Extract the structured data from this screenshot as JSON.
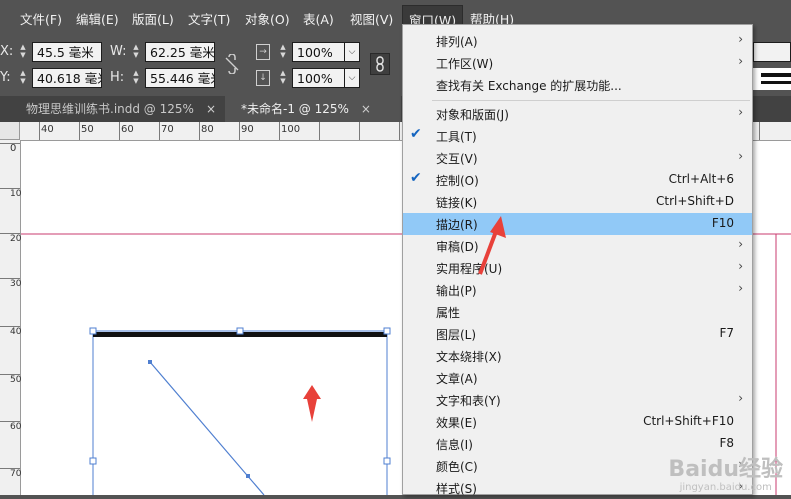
{
  "menubar": {
    "items": [
      "文件(F)",
      "编辑(E)",
      "版面(L)",
      "文字(T)",
      "对象(O)",
      "表(A)",
      "视图(V)",
      "窗口(W)",
      "帮助(H)"
    ],
    "active_index": 7
  },
  "control_panel": {
    "x_label": "X:",
    "x_value": "45.5 毫米",
    "y_label": "Y:",
    "y_value": "40.618 毫米",
    "w_label": "W:",
    "w_value": "62.25 毫米",
    "h_label": "H:",
    "h_value": "55.446 毫米",
    "scale_x": "100%",
    "scale_y": "100%"
  },
  "tabs": [
    {
      "label": "物理思维训练书.indd @ 125%",
      "close": "×",
      "active": false
    },
    {
      "label": "*未命名-1 @ 125%",
      "close": "×",
      "active": true
    }
  ],
  "ruler": {
    "h_labels": [
      "40",
      "50",
      "60",
      "70",
      "80",
      "90",
      "100"
    ],
    "v_labels": [
      "0",
      "10",
      "20",
      "30",
      "40",
      "50",
      "60",
      "70"
    ]
  },
  "window_menu": {
    "items": [
      {
        "label": "排列(A)",
        "submenu": true
      },
      {
        "label": "工作区(W)",
        "submenu": true
      },
      {
        "label": "查找有关 Exchange 的扩展功能..."
      },
      {
        "label": "对象和版面(J)",
        "submenu": true
      },
      {
        "label": "工具(T)",
        "checked": true
      },
      {
        "label": "交互(V)",
        "submenu": true
      },
      {
        "label": "控制(O)",
        "checked": true,
        "shortcut": "Ctrl+Alt+6"
      },
      {
        "label": "链接(K)",
        "shortcut": "Ctrl+Shift+D"
      },
      {
        "label": "描边(R)",
        "shortcut": "F10",
        "highlighted": true
      },
      {
        "label": "审稿(D)",
        "submenu": true
      },
      {
        "label": "实用程序(U)",
        "submenu": true
      },
      {
        "label": "输出(P)",
        "submenu": true
      },
      {
        "label": "属性"
      },
      {
        "label": "图层(L)",
        "shortcut": "F7"
      },
      {
        "label": "文本绕排(X)"
      },
      {
        "label": "文章(A)"
      },
      {
        "label": "文字和表(Y)",
        "submenu": true
      },
      {
        "label": "效果(E)",
        "shortcut": "Ctrl+Shift+F10"
      },
      {
        "label": "信息(I)",
        "shortcut": "F8"
      },
      {
        "label": "颜色(C)",
        "submenu": true
      },
      {
        "label": "样式(S)",
        "submenu": true
      }
    ],
    "check_mark": "✔",
    "arrow": "›"
  },
  "watermark": {
    "brand": "Baidu经验",
    "url": "jingyan.baidu.com"
  },
  "colors": {
    "highlight": "#91c9f7",
    "annotation_arrow": "#e8413a",
    "selection": "#4f7fd0",
    "guide": "#c93b6f"
  }
}
